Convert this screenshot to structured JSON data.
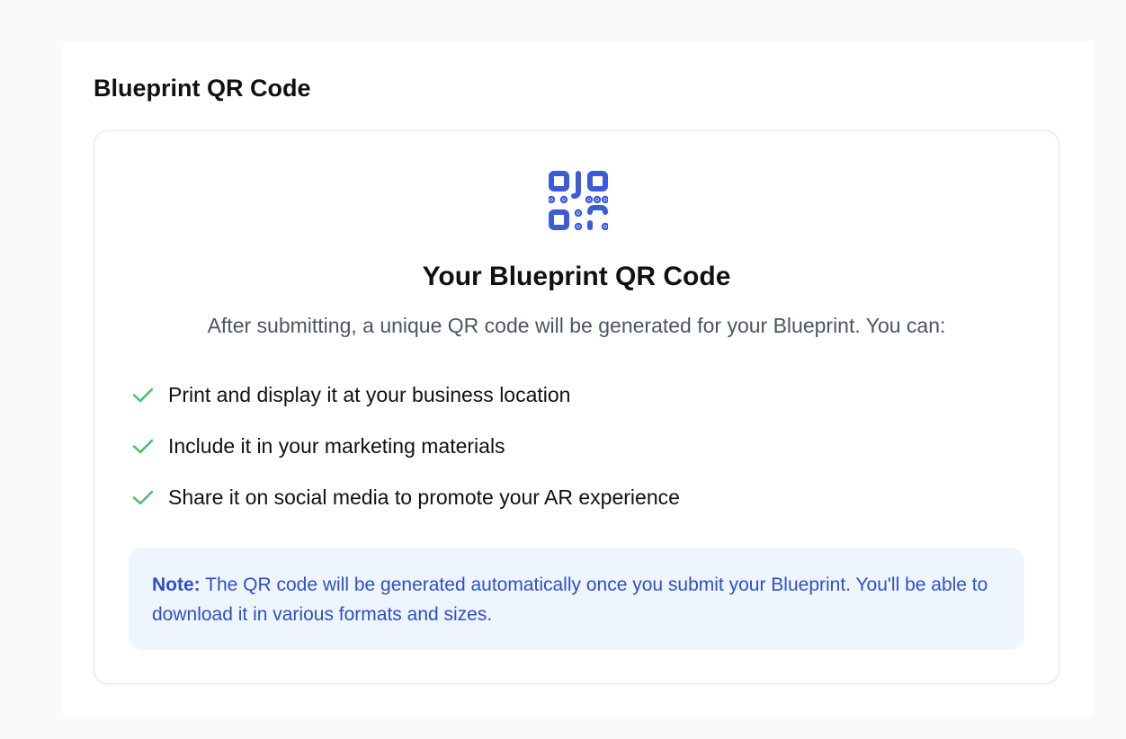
{
  "section": {
    "title": "Blueprint QR Code"
  },
  "card": {
    "icon": "qr-code-icon",
    "title": "Your Blueprint QR Code",
    "subtitle": "After submitting, a unique QR code will be generated for your Blueprint. You can:",
    "features": [
      {
        "icon": "check-icon",
        "text": "Print and display it at your business location"
      },
      {
        "icon": "check-icon",
        "text": "Include it in your marketing materials"
      },
      {
        "icon": "check-icon",
        "text": "Share it on social media to promote your AR experience"
      }
    ],
    "note": {
      "label": "Note:",
      "text": " The QR code will be generated automatically once you submit your Blueprint. You'll be able to download it in various formats and sizes."
    }
  },
  "colors": {
    "accent": "#3b5bdb",
    "check": "#3fbf69",
    "note_bg": "#eef5ff",
    "note_text": "#2f4fc4",
    "page_bg": "#f9fafb"
  }
}
